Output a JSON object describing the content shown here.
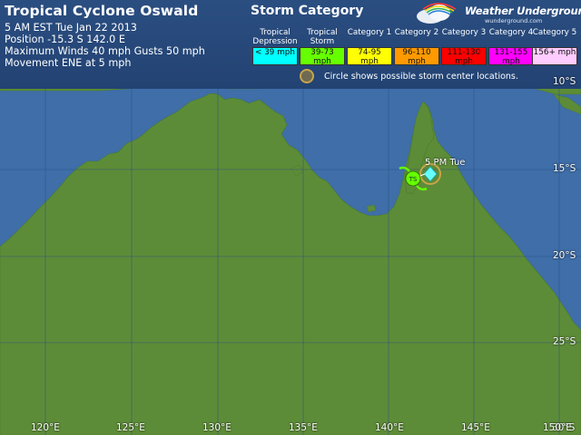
{
  "storm": {
    "title": "Tropical Cyclone Oswald",
    "time": "5 AM EST Tue Jan 22 2013",
    "position": "Position -15.3 S 142.0 E",
    "winds": "Maximum Winds 40 mph  Gusts 50 mph",
    "movement": "Movement ENE at 5 mph"
  },
  "legend": {
    "title": "Storm Category",
    "categories": [
      {
        "label": "Tropical Depression",
        "range": "< 39 mph",
        "color": "#00ffff"
      },
      {
        "label": "Tropical Storm",
        "range": "39-73 mph",
        "color": "#66ff00"
      },
      {
        "label": "Category 1",
        "range": "74-95 mph",
        "color": "#ffff00"
      },
      {
        "label": "Category 2",
        "range": "96-110 mph",
        "color": "#ff9900"
      },
      {
        "label": "Category 3",
        "range": "111-130 mph",
        "color": "#ff0000"
      },
      {
        "label": "Category 4",
        "range": "131-155 mph",
        "color": "#ff00ff"
      },
      {
        "label": "Category 5",
        "range": "156+ mph",
        "color": "#ffccff"
      }
    ],
    "circle_note": "Circle shows possible storm center locations."
  },
  "brand": {
    "name": "Weather Underground",
    "url": "wunderground.com"
  },
  "map": {
    "latitude_labels": [
      "10°S",
      "15°S",
      "20°S",
      "25°S",
      "30°S"
    ],
    "longitude_labels": [
      "120°E",
      "125°E",
      "130°E",
      "135°E",
      "140°E",
      "145°E",
      "150°E"
    ],
    "land_color": "#5d8c38",
    "water_color": "#3f6ea8"
  },
  "track": {
    "current_marker": "TS",
    "forecast_time": "5 PM Tue"
  }
}
